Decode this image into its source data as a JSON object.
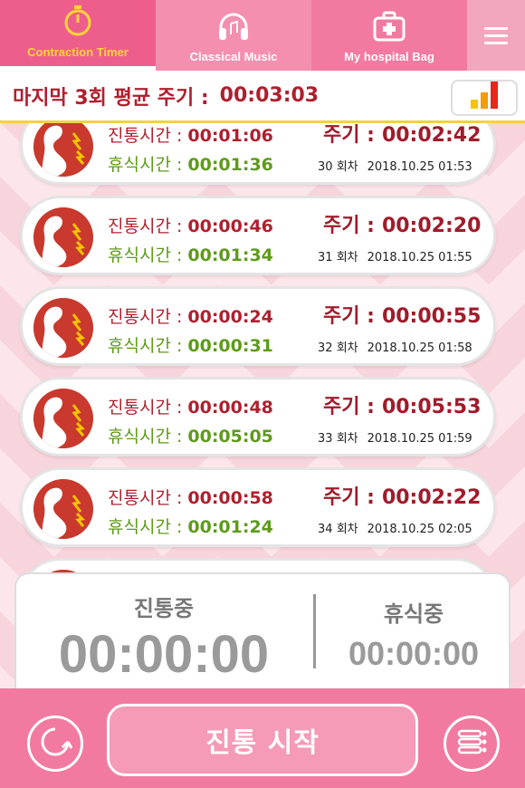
{
  "tabs": [
    {
      "label": "Contraction Timer",
      "icon": "stopwatch-icon",
      "active": true
    },
    {
      "label": "Classical Music",
      "icon": "headphones-icon",
      "active": false
    },
    {
      "label": "My hospital Bag",
      "icon": "medical-bag-icon",
      "active": false
    }
  ],
  "average": {
    "label": "마지막 3회 평균 주기 :",
    "value": "00:03:03"
  },
  "labels": {
    "pain": "진통시간 :",
    "rest": "휴식시간 :",
    "cycle": "주기 :",
    "round_suffix": "회차"
  },
  "records": [
    {
      "pain": "00:01:06",
      "rest": "00:01:36",
      "cycle": "00:02:42",
      "round": "30",
      "datetime": "2018.10.25 01:53"
    },
    {
      "pain": "00:00:46",
      "rest": "00:01:34",
      "cycle": "00:02:20",
      "round": "31",
      "datetime": "2018.10.25 01:55"
    },
    {
      "pain": "00:00:24",
      "rest": "00:00:31",
      "cycle": "00:00:55",
      "round": "32",
      "datetime": "2018.10.25 01:58"
    },
    {
      "pain": "00:00:48",
      "rest": "00:05:05",
      "cycle": "00:05:53",
      "round": "33",
      "datetime": "2018.10.25 01:59"
    },
    {
      "pain": "00:00:58",
      "rest": "00:01:24",
      "cycle": "00:02:22",
      "round": "34",
      "datetime": "2018.10.25 02:05"
    }
  ],
  "timer": {
    "pain_label": "진통중",
    "pain_value": "00:00:00",
    "rest_label": "휴식중",
    "rest_value": "00:00:00"
  },
  "bottom": {
    "start_label": "진통 시작"
  },
  "colors": {
    "primary": "#f27aa0",
    "pain": "#b01f2e",
    "rest": "#5e9b1a",
    "accent": "#ffd43b"
  }
}
